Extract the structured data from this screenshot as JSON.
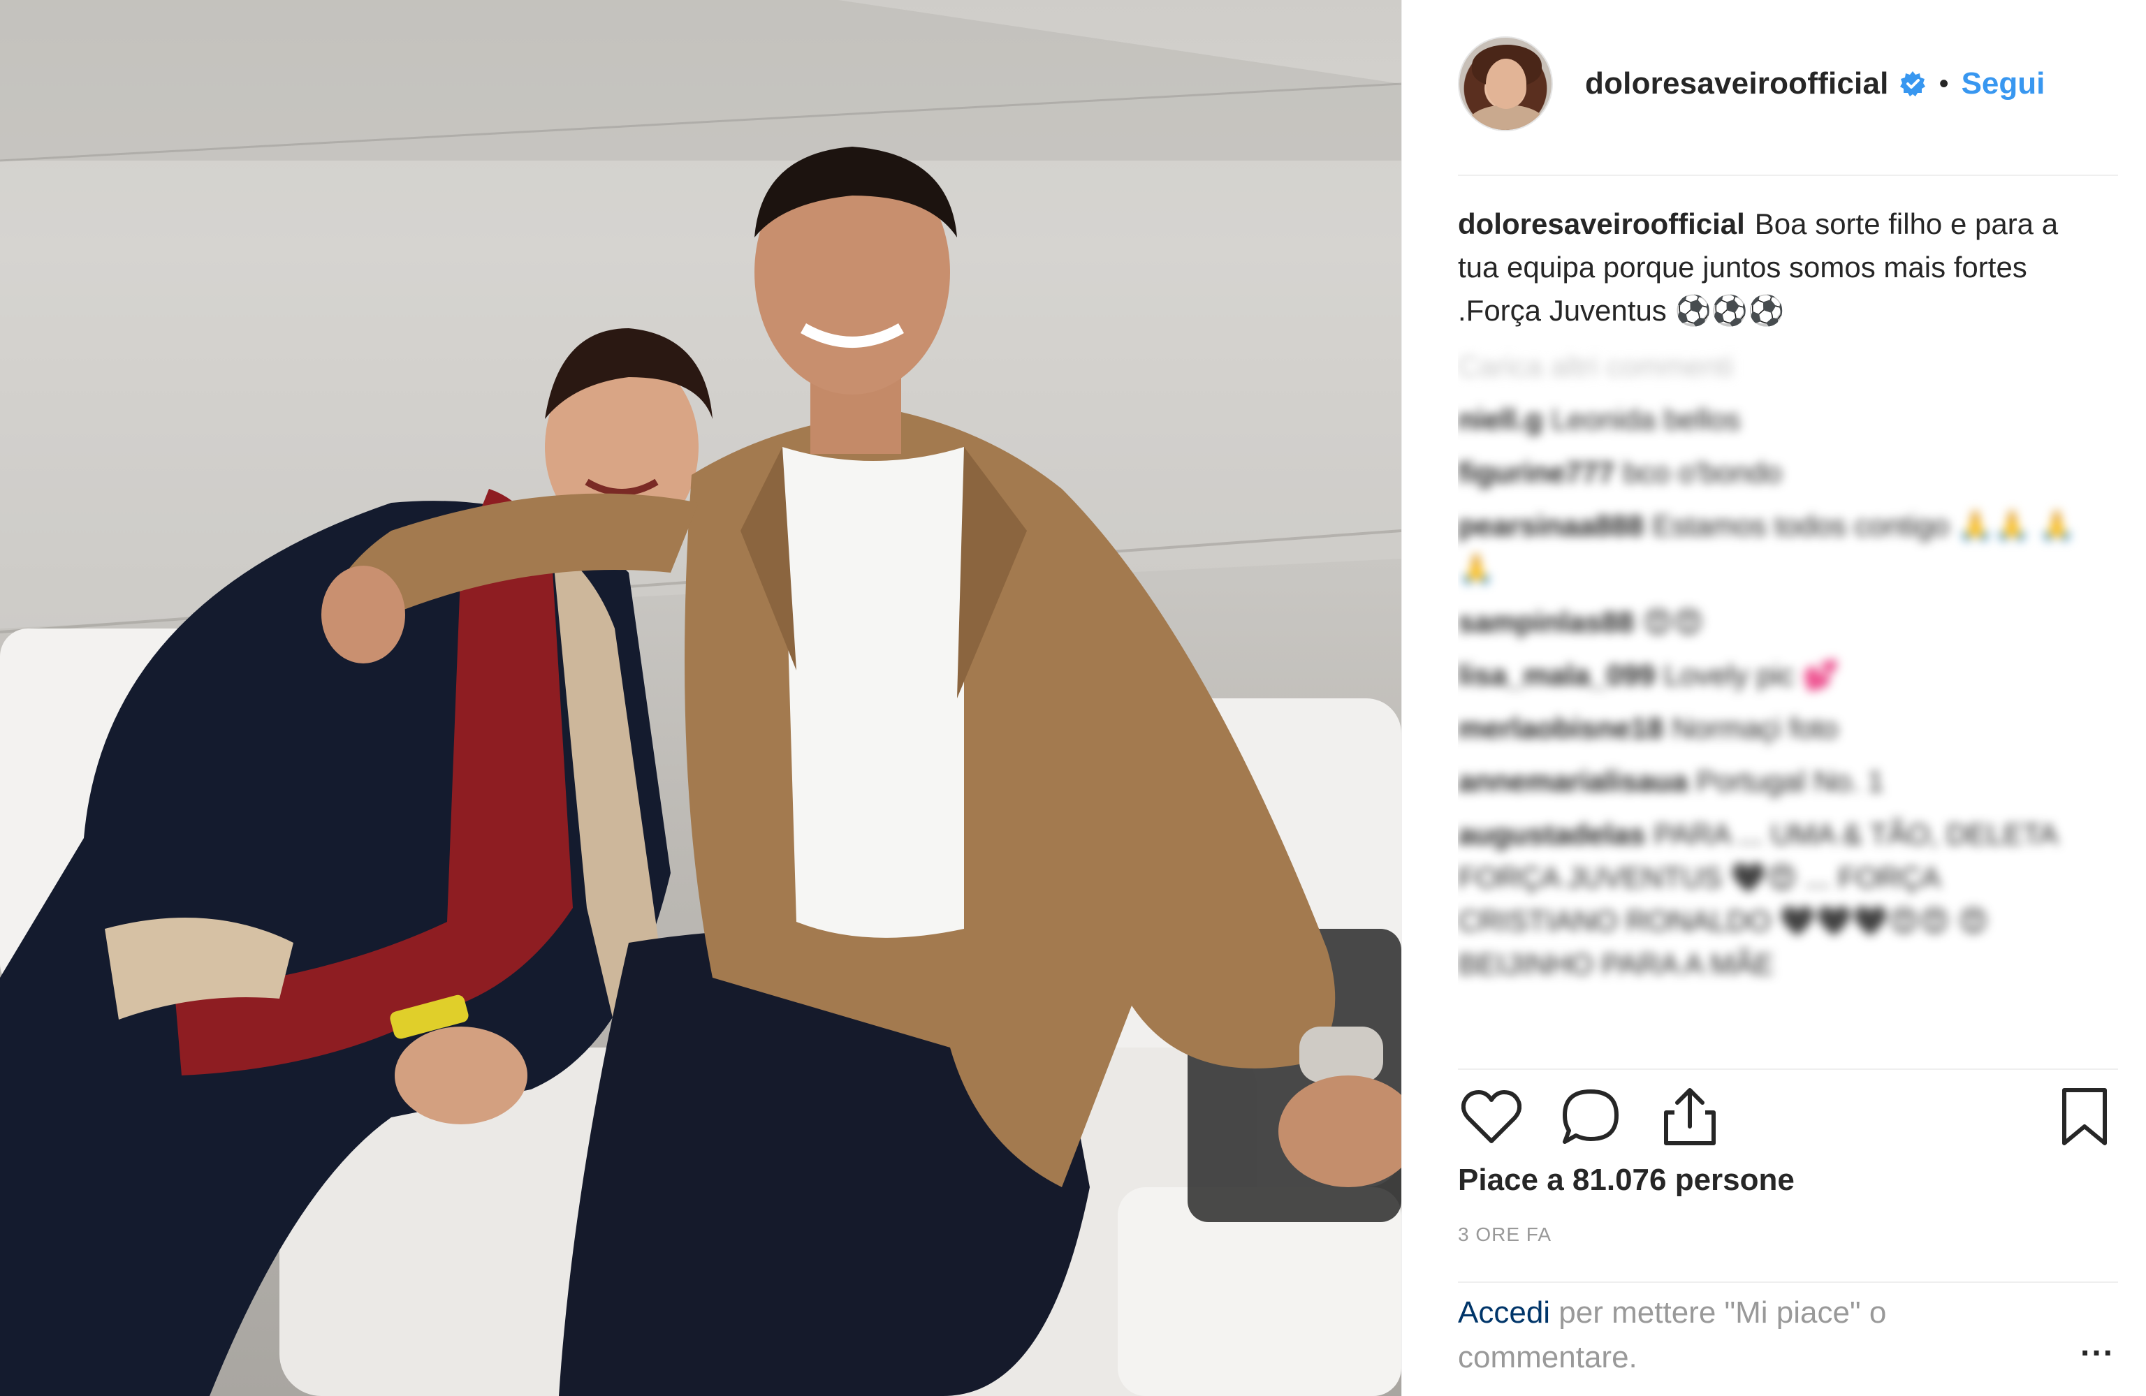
{
  "post": {
    "photo_alt": "",
    "username": "doloresaveiroofficial",
    "separator": "•",
    "follow_label": "Segui",
    "caption_username": "doloresaveiroofficial",
    "caption_text": "Boa sorte filho e para a tua equipa porque juntos somos mais fortes .Força Juventus ⚽⚽⚽",
    "load_more": "Carica altri commenti",
    "comments": [
      {
        "user": "niell.g",
        "text": "Leonida bellos"
      },
      {
        "user": "figurine777",
        "text": "bco o'bondo"
      },
      {
        "user": "pearsinaa888",
        "text": "Estamos todos contigo 🙏🙏 🙏🙏"
      },
      {
        "user": "sampinlas88",
        "text": "😍😍"
      },
      {
        "user": "lisa_mala_099",
        "text": "Lovely pic 💕"
      },
      {
        "user": "merlaobisne18",
        "text": "Normaçi foto"
      },
      {
        "user": "annemarialisaua",
        "text": "Portugal No. 1"
      },
      {
        "user": "augustadelas",
        "text": "PARA ... UMA & TÃO, DELETA FORÇA JUVENTUS 🖤😍 ... FORÇA CRISTIANO RONALDO 🖤🖤🖤😍😍 😍 BEIJINHO PARA A MÃE"
      }
    ],
    "likes_text": "Piace a 81.076 persone",
    "time_text": "3 ORE FA",
    "login_link": "Accedi",
    "login_text": " per mettere \"Mi piace\" o commentare.",
    "more_label": "...",
    "icons": {
      "like": "heart-icon",
      "comment": "comment-icon",
      "share": "share-icon",
      "save": "bookmark-icon",
      "verified": "verified-badge-icon"
    },
    "colors": {
      "link": "#3897f0",
      "text": "#262626",
      "muted": "#999999"
    }
  }
}
